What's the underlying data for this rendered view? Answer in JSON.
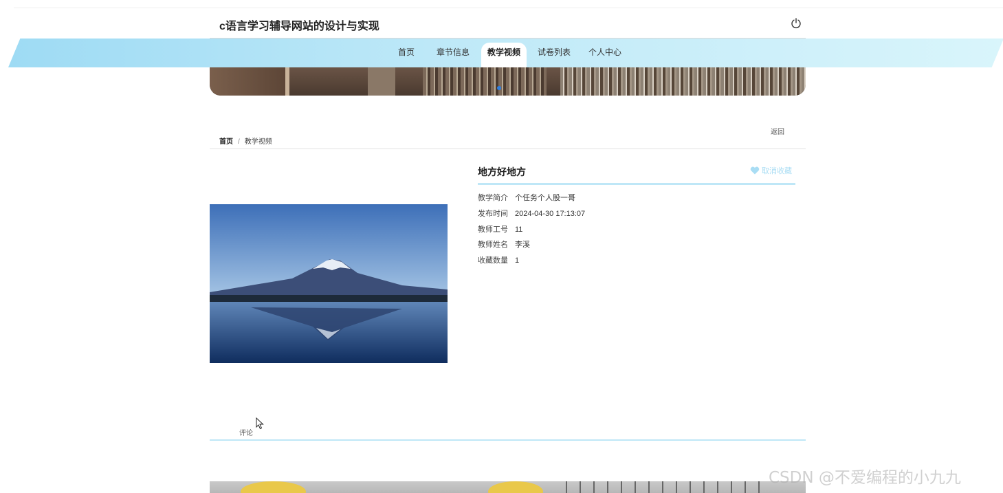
{
  "header": {
    "site_title": "c语言学习辅导网站的设计与实现",
    "power_icon": "power-icon"
  },
  "nav": {
    "items": [
      {
        "label": "首页",
        "active": false
      },
      {
        "label": "章节信息",
        "active": false
      },
      {
        "label": "教学视频",
        "active": true
      },
      {
        "label": "试卷列表",
        "active": false
      },
      {
        "label": "个人中心",
        "active": false
      }
    ],
    "band_color": "#9edbf4",
    "active_bg": "#ffffff"
  },
  "breadcrumb": {
    "home": "首页",
    "separator": "/",
    "current": "教学视频",
    "back_label": "返回"
  },
  "detail": {
    "title": "地方好地方",
    "favorite_label": "取消收藏",
    "favorite_icon": "heart-icon",
    "accent_color": "#bfe7f7",
    "fields": [
      {
        "label": "教学简介",
        "value": "个任务个人股一哥"
      },
      {
        "label": "发布时间",
        "value": "2024-04-30 17:13:07"
      },
      {
        "label": "教师工号",
        "value": "11"
      },
      {
        "label": "教师姓名",
        "value": "李溪"
      },
      {
        "label": "收藏数量",
        "value": "1"
      }
    ]
  },
  "comments": {
    "label": "评论"
  },
  "watermark": "CSDN @不爱编程的小九九"
}
